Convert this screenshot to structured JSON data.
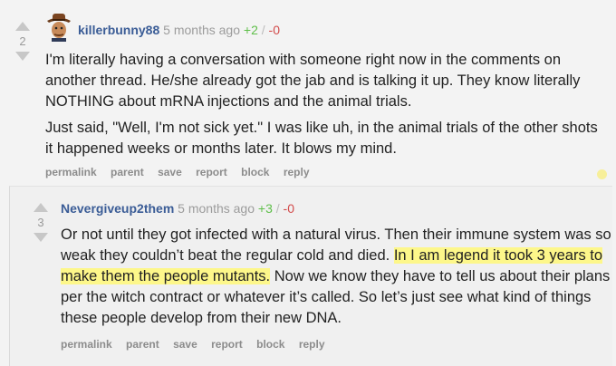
{
  "comments": [
    {
      "author": "killerbunny88",
      "time": "5 months ago",
      "plus": "+2",
      "sep": "/",
      "minus": "-0",
      "score": "2",
      "paragraphs": [
        "I'm literally having a conversation with someone right now in the comments on another thread. He/she already got the jab and is talking it up. They know literally NOTHING about mRNA injections and the animal trials.",
        "Just said, \"Well, I'm not sick yet.\" I was like uh, in the animal trials of the other shots it happened weeks or months later. It blows my mind."
      ],
      "actions": [
        "permalink",
        "parent",
        "save",
        "report",
        "block",
        "reply"
      ]
    },
    {
      "author": "Nevergiveup2them",
      "time": "5 months ago",
      "plus": "+3",
      "sep": "/",
      "minus": "-0",
      "score": "3",
      "text_before": "Or not until they got infected with a natural virus. Then their immune system was so weak they couldn’t beat the regular cold and died. ",
      "text_highlight": "In I am legend it took 3 years to make them the people mutants.",
      "text_after": " Now we know they have to tell us about their plans per the witch contract or whatever it’s called. So let’s just see what kind of things these people develop from their new DNA.",
      "actions": [
        "permalink",
        "parent",
        "save",
        "report",
        "block",
        "reply"
      ]
    }
  ]
}
